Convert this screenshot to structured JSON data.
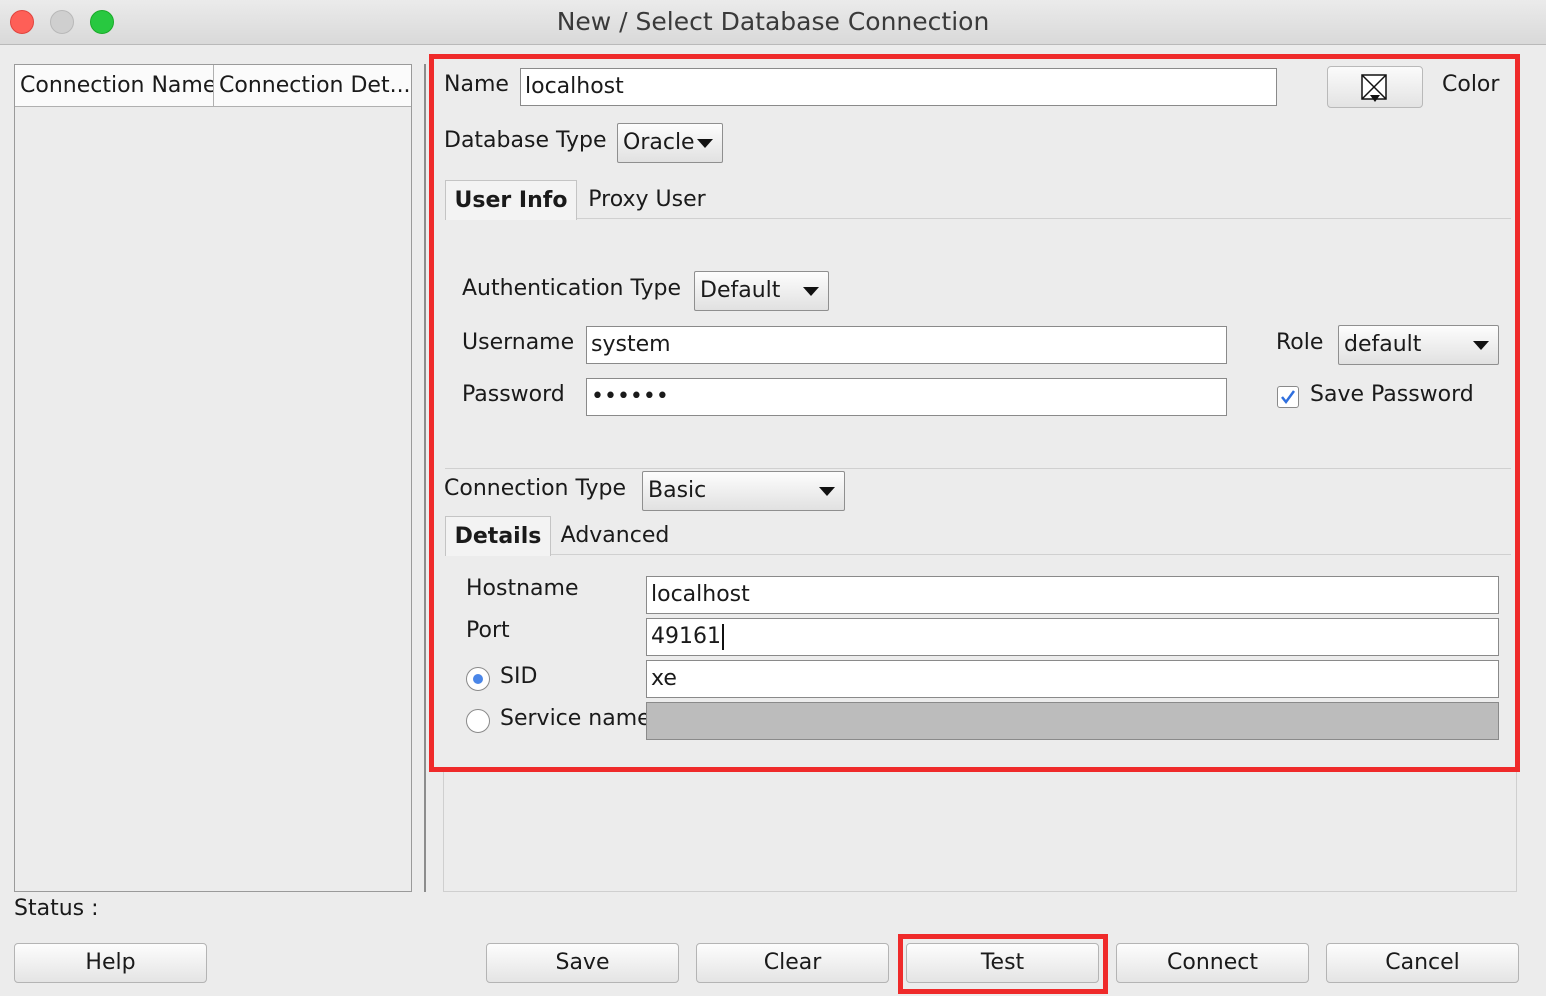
{
  "window": {
    "title": "New / Select Database Connection"
  },
  "list": {
    "columns": [
      "Connection Name",
      "Connection Det..."
    ],
    "status_label": "Status :"
  },
  "form": {
    "name_label": "Name",
    "name_value": "localhost",
    "color_label": "Color",
    "db_type_label": "Database Type",
    "db_type_value": "Oracle",
    "tabs": [
      "User Info",
      "Proxy User"
    ],
    "auth_type_label": "Authentication Type",
    "auth_type_value": "Default",
    "username_label": "Username",
    "username_value": "system",
    "role_label": "Role",
    "role_value": "default",
    "password_label": "Password",
    "password_value": "••••••",
    "save_password_label": "Save Password",
    "save_password_checked": true,
    "connection_type_label": "Connection Type",
    "connection_type_value": "Basic",
    "conn_tabs": [
      "Details",
      "Advanced"
    ],
    "hostname_label": "Hostname",
    "hostname_value": "localhost",
    "port_label": "Port",
    "port_value": "49161",
    "sid_label": "SID",
    "sid_value": "xe",
    "service_name_label": "Service name",
    "service_name_value": ""
  },
  "buttons": {
    "help": "Help",
    "save": "Save",
    "clear": "Clear",
    "test": "Test",
    "connect": "Connect",
    "cancel": "Cancel"
  },
  "colors": {
    "highlight": "#ef2a2a",
    "accent": "#4a86e8"
  }
}
